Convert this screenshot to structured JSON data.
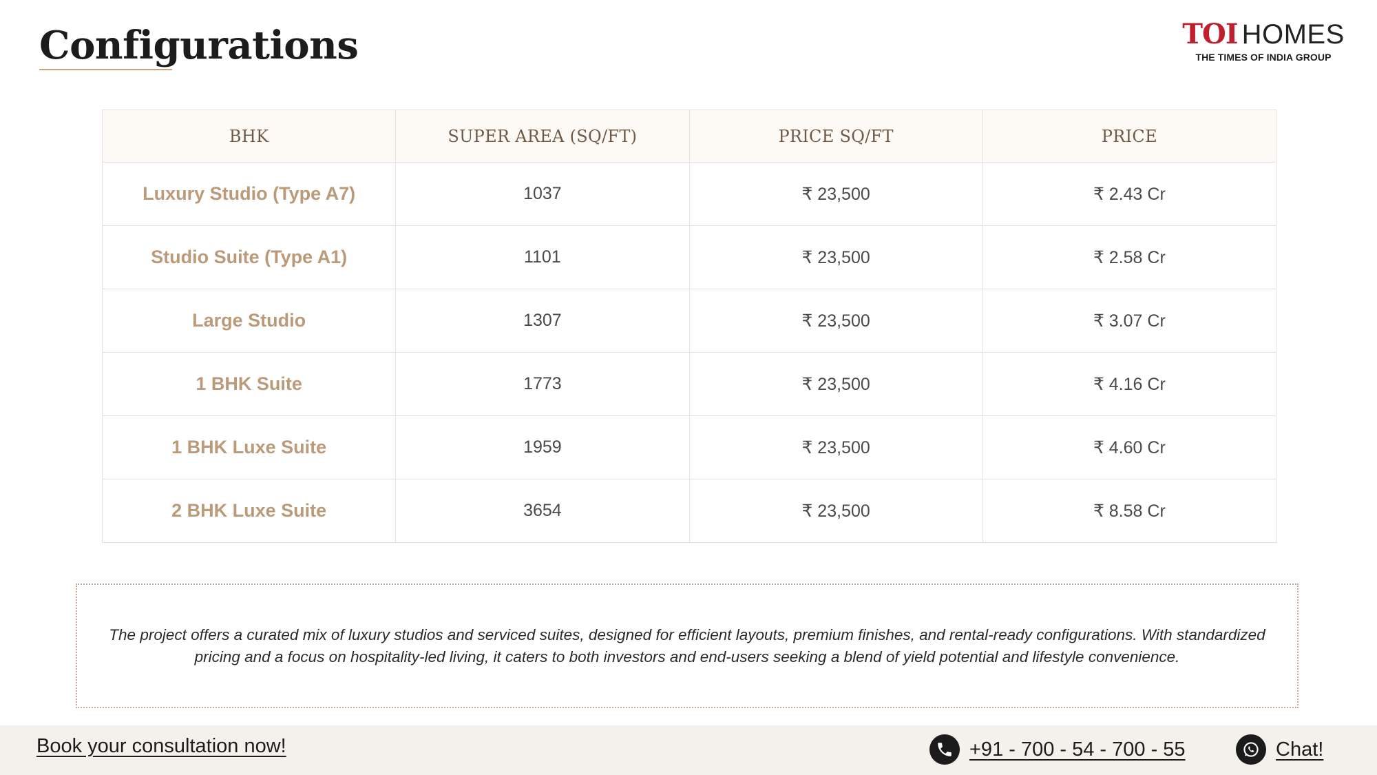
{
  "header": {
    "title": "Configurations",
    "logo": {
      "brand_red": "TOI",
      "brand_dark": "HOMES",
      "subtitle": "THE TIMES OF INDIA GROUP"
    }
  },
  "table": {
    "columns": [
      "BHK",
      "SUPER AREA (SQ/FT)",
      "PRICE SQ/FT",
      "PRICE"
    ],
    "rows": [
      {
        "bhk": "Luxury Studio (Type A7)",
        "area": "1037",
        "rate": "₹ 23,500",
        "price": "₹ 2.43 Cr"
      },
      {
        "bhk": "Studio Suite (Type A1)",
        "area": "1101",
        "rate": "₹ 23,500",
        "price": "₹ 2.58 Cr"
      },
      {
        "bhk": "Large Studio",
        "area": "1307",
        "rate": "₹ 23,500",
        "price": "₹ 3.07 Cr"
      },
      {
        "bhk": "1 BHK Suite",
        "area": "1773",
        "rate": "₹ 23,500",
        "price": "₹ 4.16 Cr"
      },
      {
        "bhk": "1 BHK Luxe Suite",
        "area": "1959",
        "rate": "₹ 23,500",
        "price": "₹ 4.60 Cr"
      },
      {
        "bhk": "2 BHK Luxe Suite",
        "area": "3654",
        "rate": "₹ 23,500",
        "price": "₹ 8.58 Cr"
      }
    ]
  },
  "description": "The project offers a curated mix of luxury studios and serviced suites, designed for efficient layouts, premium finishes, and rental-ready configurations. With standardized pricing and a focus on hospitality-led living, it caters to both investors and end-users seeking a blend of yield potential and lifestyle convenience.",
  "footer": {
    "cta": "Book your consultation now!",
    "phone": "+91 - 700 - 54 - 700 - 55",
    "phone_icon": "phone-icon",
    "chat": "Chat!",
    "chat_icon": "whatsapp-icon"
  },
  "colors": {
    "accent_gold": "#bb9a79",
    "header_bg": "#fdf9f5",
    "brand_red": "#c0202e",
    "footer_bg": "#f4f0eb"
  }
}
